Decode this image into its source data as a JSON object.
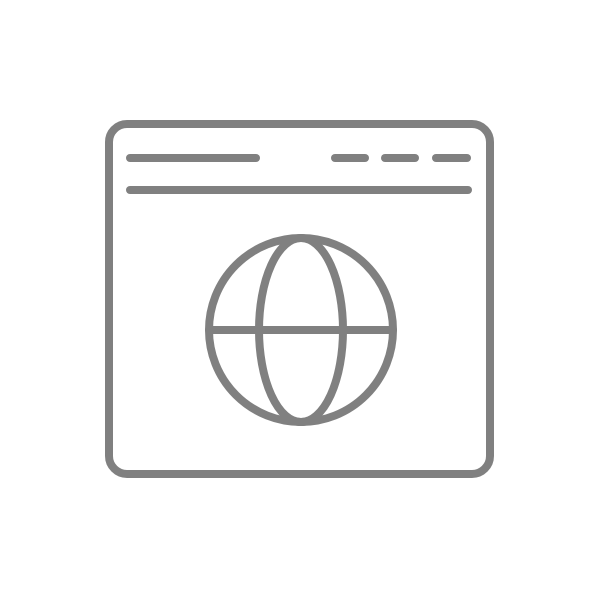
{
  "icon": {
    "name": "browser-window-globe-icon",
    "stroke_color": "#808080",
    "background_color": "#ffffff",
    "parts": {
      "window": "browser-window-frame",
      "address_bar": "address-bar-line",
      "menu_dots": "menu-dashes",
      "divider": "toolbar-divider",
      "globe": "globe-icon"
    }
  }
}
